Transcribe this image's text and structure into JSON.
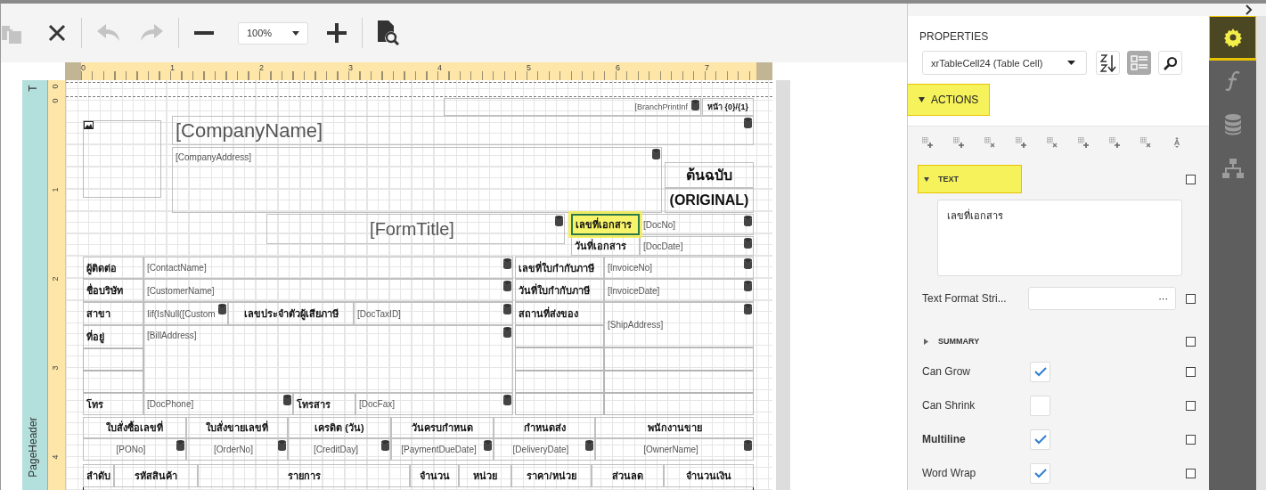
{
  "toolbar": {
    "buttons": [
      {
        "kind": "copy",
        "disabled": true
      },
      {
        "kind": "close",
        "disabled": false
      },
      {
        "kind": "undo",
        "disabled": true
      },
      {
        "kind": "redo",
        "disabled": true
      },
      {
        "kind": "zoom_out",
        "disabled": false
      },
      {
        "kind": "zoom_select",
        "value": "100%"
      },
      {
        "kind": "zoom_in",
        "disabled": false
      },
      {
        "kind": "preview",
        "disabled": false
      }
    ]
  },
  "rulers": {
    "horizontal": [
      "0",
      "1",
      "2",
      "3",
      "4",
      "5",
      "6",
      "7"
    ],
    "vertical": [
      "0",
      "0",
      "1",
      "2",
      "3",
      "4"
    ]
  },
  "bands": [
    {
      "name": "T"
    },
    {
      "name": "PageHeader"
    }
  ],
  "report_controls": [
    {
      "kind": "field",
      "text": "[BranchPrintInf",
      "bound": true,
      "selected": false
    },
    {
      "kind": "label",
      "text": "หน้า {0}/{1}",
      "bound": false,
      "selected": false
    },
    {
      "kind": "picture_box",
      "bound": false,
      "selected": false
    },
    {
      "kind": "field",
      "text": "[CompanyName]",
      "bound": true,
      "selected": false
    },
    {
      "kind": "field",
      "text": "[CompanyAddress]",
      "bound": true,
      "selected": false
    },
    {
      "kind": "label",
      "text": "ต้นฉบับ",
      "bound": false,
      "selected": false
    },
    {
      "kind": "label",
      "text": "(ORIGINAL)",
      "bound": false,
      "selected": false
    },
    {
      "kind": "field",
      "text": "[FormTitle]",
      "bound": true,
      "selected": false
    },
    {
      "kind": "label",
      "text": "เลขที่เอกสาร",
      "bound": false,
      "selected": true
    },
    {
      "kind": "field",
      "text": "[DocNo]",
      "bound": true,
      "selected": false
    },
    {
      "kind": "label",
      "text": "วันที่เอกสาร",
      "bound": false,
      "selected": false
    },
    {
      "kind": "field",
      "text": "[DocDate]",
      "bound": true,
      "selected": false
    },
    {
      "kind": "label",
      "text": "ผู้ติดต่อ",
      "bound": false,
      "selected": false
    },
    {
      "kind": "field",
      "text": "[ContactName]",
      "bound": true,
      "selected": false
    },
    {
      "kind": "label",
      "text": "ชื่อบริษัท",
      "bound": false,
      "selected": false
    },
    {
      "kind": "field",
      "text": "[CustomerName]",
      "bound": true,
      "selected": false
    },
    {
      "kind": "label",
      "text": "สาขา",
      "bound": false,
      "selected": false
    },
    {
      "kind": "field",
      "text": "Iif(IsNull([Custom",
      "bound": true,
      "selected": false
    },
    {
      "kind": "label",
      "text": "เลขประจำตัวผู้เสียภาษี",
      "bound": false,
      "selected": false
    },
    {
      "kind": "field",
      "text": "[DocTaxID]",
      "bound": true,
      "selected": false
    },
    {
      "kind": "label",
      "text": "ที่อยู่",
      "bound": false,
      "selected": false
    },
    {
      "kind": "field",
      "text": "[BillAddress]",
      "bound": true,
      "selected": false
    },
    {
      "kind": "label",
      "text": "โทร",
      "bound": false,
      "selected": false
    },
    {
      "kind": "field",
      "text": "[DocPhone]",
      "bound": true,
      "selected": false
    },
    {
      "kind": "label",
      "text": "โทรสาร",
      "bound": false,
      "selected": false
    },
    {
      "kind": "field",
      "text": "[DocFax]",
      "bound": true,
      "selected": false
    },
    {
      "kind": "label",
      "text": "เลขที่ใบกำกับภาษี",
      "bound": false,
      "selected": false
    },
    {
      "kind": "field",
      "text": "[InvoiceNo]",
      "bound": true,
      "selected": false
    },
    {
      "kind": "label",
      "text": "วันที่ใบกำกับภาษี",
      "bound": false,
      "selected": false
    },
    {
      "kind": "field",
      "text": "[InvoiceDate]",
      "bound": true,
      "selected": false
    },
    {
      "kind": "label",
      "text": "สถานที่ส่งของ",
      "bound": false,
      "selected": false
    },
    {
      "kind": "field",
      "text": "[ShipAddress]",
      "bound": true,
      "selected": false
    },
    {
      "kind": "label",
      "text": "ใบสั่งซื้อเลขที่",
      "bound": false,
      "selected": false
    },
    {
      "kind": "label",
      "text": "ใบสั่งขายเลขที่",
      "bound": false,
      "selected": false
    },
    {
      "kind": "label",
      "text": "เครดิต (วัน)",
      "bound": false,
      "selected": false
    },
    {
      "kind": "label",
      "text": "วันครบกำหนด",
      "bound": false,
      "selected": false
    },
    {
      "kind": "label",
      "text": "กำหนดส่ง",
      "bound": false,
      "selected": false
    },
    {
      "kind": "label",
      "text": "พนักงานขาย",
      "bound": false,
      "selected": false
    },
    {
      "kind": "field",
      "text": "[PONo]",
      "bound": true,
      "selected": false
    },
    {
      "kind": "field",
      "text": "[OrderNo]",
      "bound": true,
      "selected": false
    },
    {
      "kind": "field",
      "text": "[CreditDay]",
      "bound": true,
      "selected": false
    },
    {
      "kind": "field",
      "text": "[PaymentDueDate]",
      "bound": true,
      "selected": false
    },
    {
      "kind": "field",
      "text": "[DeliveryDate]",
      "bound": true,
      "selected": false
    },
    {
      "kind": "field",
      "text": "[OwnerName]",
      "bound": true,
      "selected": false
    },
    {
      "kind": "label",
      "text": "ลำดับ",
      "bound": false,
      "selected": false
    },
    {
      "kind": "label",
      "text": "รหัสสินค้า",
      "bound": false,
      "selected": false
    },
    {
      "kind": "label",
      "text": "รายการ",
      "bound": false,
      "selected": false
    },
    {
      "kind": "label",
      "text": "จำนวน",
      "bound": false,
      "selected": false
    },
    {
      "kind": "label",
      "text": "หน่วย",
      "bound": false,
      "selected": false
    },
    {
      "kind": "label",
      "text": "ราคา/หน่วย",
      "bound": false,
      "selected": false
    },
    {
      "kind": "label",
      "text": "ส่วนลด",
      "bound": false,
      "selected": false
    },
    {
      "kind": "label",
      "text": "จำนวนเงิน",
      "bound": false,
      "selected": false
    }
  ],
  "properties_panel": {
    "title": "PROPERTIES",
    "component_select": "xrTableCell24 (Table Cell)",
    "view_buttons": [
      {
        "kind": "sort",
        "selected": false
      },
      {
        "kind": "categories",
        "selected": true
      },
      {
        "kind": "search",
        "selected": false
      }
    ],
    "actions": {
      "label": "ACTIONS",
      "expanded": true,
      "highlighted": true
    },
    "properties": [
      {
        "kind": "section",
        "label": "TEXT",
        "expanded": true,
        "highlighted": true
      },
      {
        "kind": "textarea",
        "value": "เลขที่เอกสาร"
      },
      {
        "kind": "ellipsis_field",
        "label": "Text Format Stri...",
        "button": "···"
      },
      {
        "kind": "section",
        "label": "SUMMARY",
        "expanded": false,
        "highlighted": false
      },
      {
        "kind": "checkbox",
        "label": "Can Grow",
        "checked": true,
        "bold": false
      },
      {
        "kind": "checkbox",
        "label": "Can Shrink",
        "checked": false,
        "bold": false
      },
      {
        "kind": "checkbox",
        "label": "Multiline",
        "checked": true,
        "bold": true
      },
      {
        "kind": "checkbox",
        "label": "Word Wrap",
        "checked": true,
        "bold": false
      }
    ]
  },
  "side_tabs": [
    {
      "kind": "properties",
      "selected": true
    },
    {
      "kind": "expressions",
      "selected": false
    },
    {
      "kind": "data",
      "selected": false
    },
    {
      "kind": "structure",
      "selected": false
    }
  ]
}
